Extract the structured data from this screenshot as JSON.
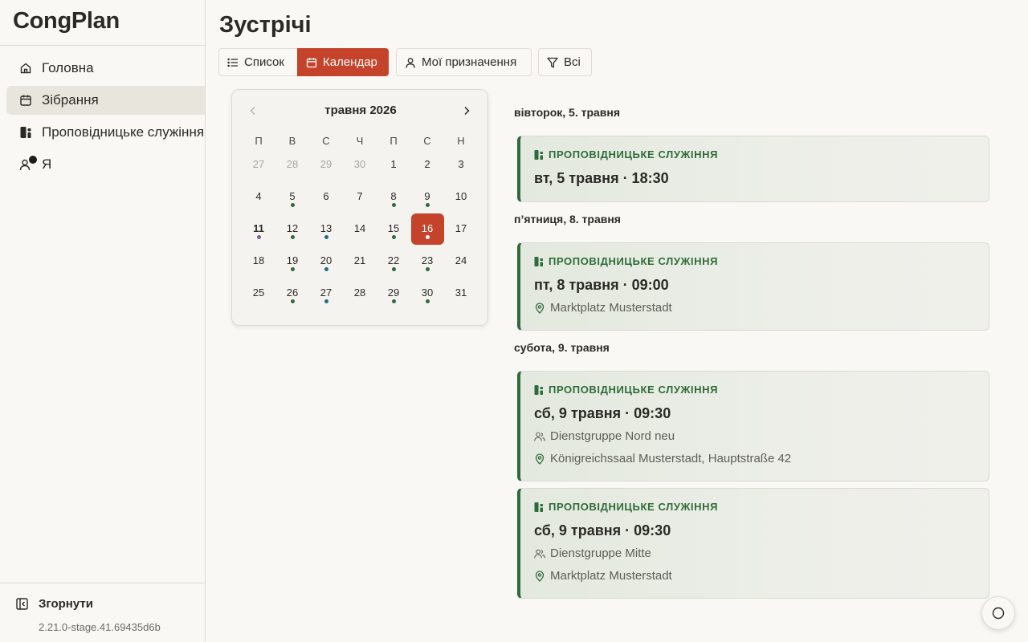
{
  "app": {
    "name": "CongPlan"
  },
  "sidebar": {
    "items": [
      {
        "label": "Головна",
        "icon": "home-icon",
        "active": false
      },
      {
        "label": "Зібрання",
        "icon": "calendar-icon",
        "active": true
      },
      {
        "label": "Проповідницьке служіння",
        "icon": "ministry-icon",
        "active": false
      },
      {
        "label": "Я",
        "icon": "user-icon",
        "active": false
      }
    ],
    "collapse_label": "Згорнути",
    "version": "2.21.0-stage.41.69435d6b"
  },
  "page": {
    "title": "Зустрічі"
  },
  "toolbar": {
    "list_label": "Список",
    "calendar_label": "Календар",
    "my_assignments_label": "Мої призначення",
    "filter_label": "Всі"
  },
  "calendar": {
    "month_label": "травня 2026",
    "weekdays": [
      "П",
      "В",
      "С",
      "Ч",
      "П",
      "С",
      "Н"
    ],
    "weeks": [
      [
        {
          "d": "27",
          "muted": true
        },
        {
          "d": "28",
          "muted": true
        },
        {
          "d": "29",
          "muted": true
        },
        {
          "d": "30",
          "muted": true
        },
        {
          "d": "1"
        },
        {
          "d": "2"
        },
        {
          "d": "3"
        }
      ],
      [
        {
          "d": "4"
        },
        {
          "d": "5",
          "dot": "green"
        },
        {
          "d": "6"
        },
        {
          "d": "7"
        },
        {
          "d": "8",
          "dot": "green"
        },
        {
          "d": "9",
          "dot": "green"
        },
        {
          "d": "10"
        }
      ],
      [
        {
          "d": "11",
          "today": true,
          "dot": "purple"
        },
        {
          "d": "12",
          "dot": "green"
        },
        {
          "d": "13",
          "dot": "teal"
        },
        {
          "d": "14"
        },
        {
          "d": "15",
          "dot": "green"
        },
        {
          "d": "16",
          "selected": true,
          "dot": "white"
        },
        {
          "d": "17"
        }
      ],
      [
        {
          "d": "18"
        },
        {
          "d": "19",
          "dot": "green"
        },
        {
          "d": "20",
          "dot": "teal"
        },
        {
          "d": "21"
        },
        {
          "d": "22",
          "dot": "green"
        },
        {
          "d": "23",
          "dot": "green"
        },
        {
          "d": "24"
        }
      ],
      [
        {
          "d": "25"
        },
        {
          "d": "26",
          "dot": "green"
        },
        {
          "d": "27",
          "dot": "teal"
        },
        {
          "d": "28"
        },
        {
          "d": "29",
          "dot": "green"
        },
        {
          "d": "30",
          "dot": "green"
        },
        {
          "d": "31"
        }
      ]
    ]
  },
  "colors": {
    "accent": "#c5432a",
    "ministry_green": "#2e6b3a",
    "dot_green": "#2e6b3a",
    "dot_teal": "#1f6f78",
    "dot_purple": "#7b5ea7",
    "dot_white": "#ffffff"
  },
  "events": {
    "days": [
      {
        "heading": "вівторок, 5. травня"
      },
      {
        "heading": "п’ятниця, 8. травня"
      },
      {
        "heading": "субота, 9. травня"
      }
    ],
    "cards": [
      {
        "type": "ПРОПОВІДНИЦЬКЕ СЛУЖІННЯ",
        "time": "вт, 5 травня · 18:30"
      },
      {
        "type": "ПРОПОВІДНИЦЬКЕ СЛУЖІННЯ",
        "time": "пт, 8 травня · 09:00",
        "location": "Marktplatz Musterstadt"
      },
      {
        "type": "ПРОПОВІДНИЦЬКЕ СЛУЖІННЯ",
        "time": "сб, 9 травня · 09:30",
        "group": "Dienstgruppe Nord neu",
        "location": "Königreichssaal Musterstadt, Hauptstraße 42"
      },
      {
        "type": "ПРОПОВІДНИЦЬКЕ СЛУЖІННЯ",
        "time": "сб, 9 травня · 09:30",
        "group": "Dienstgruppe Mitte",
        "location": "Marktplatz Musterstadt"
      }
    ]
  }
}
